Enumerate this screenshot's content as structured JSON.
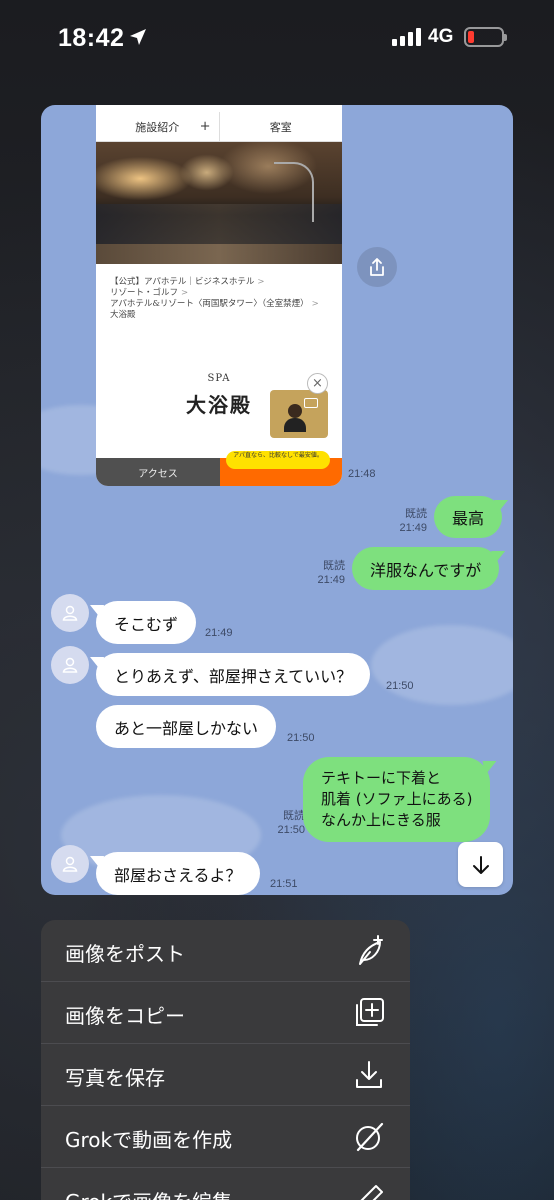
{
  "status_bar": {
    "time": "18:42",
    "network": "4G",
    "battery_color": "#ff3b30"
  },
  "shared_image": {
    "tabs": [
      "施設紹介",
      "客室"
    ],
    "tab_plus": "+",
    "breadcrumb": [
      "【公式】アパホテル｜ビジネスホテル",
      "リゾート・ゴルフ",
      "アパホテル&リゾート〈両国駅タワー〉（全室禁煙）",
      "大浴殿"
    ],
    "breadcrumb_sep": ">",
    "spa_label": "SPA",
    "spa_title": "大浴殿",
    "close_glyph": "×",
    "access_label": "アクセス",
    "promo_text": "アパ直なら、比較なしで最安値。",
    "time": "21:48"
  },
  "messages": [
    {
      "side": "me",
      "text": "最高",
      "read": "既読",
      "time": "21:49"
    },
    {
      "side": "me",
      "text": "洋服なんですが",
      "read": "既読",
      "time": "21:49"
    },
    {
      "side": "other",
      "text": "そこむず",
      "time": "21:49"
    },
    {
      "side": "other",
      "text": "とりあえず、部屋押さえていい？",
      "time": "21:50"
    },
    {
      "side": "other",
      "text": "あと一部屋しかない",
      "time": "21:50"
    },
    {
      "side": "me",
      "lines": [
        "テキトーに下着と",
        "肌着 (ソファ上にある)",
        "なんか上にきる服"
      ],
      "read": "既読",
      "time": "21:50"
    },
    {
      "side": "other",
      "text": "部屋おさえるよ？",
      "time": "21:51"
    }
  ],
  "context_menu": {
    "items": [
      {
        "label": "画像をポスト",
        "icon": "feather-plus-icon"
      },
      {
        "label": "画像をコピー",
        "icon": "copy-plus-icon"
      },
      {
        "label": "写真を保存",
        "icon": "download-icon"
      },
      {
        "label": "Grokで動画を作成",
        "icon": "grok-icon"
      },
      {
        "label": "Grokで画像を編集",
        "icon": "pencil-icon"
      }
    ]
  },
  "colors": {
    "chat_bg": "#8da7d9",
    "my_bubble": "#7ee07e",
    "other_bubble": "#ffffff",
    "menu_bg": "#3a3a3c"
  }
}
